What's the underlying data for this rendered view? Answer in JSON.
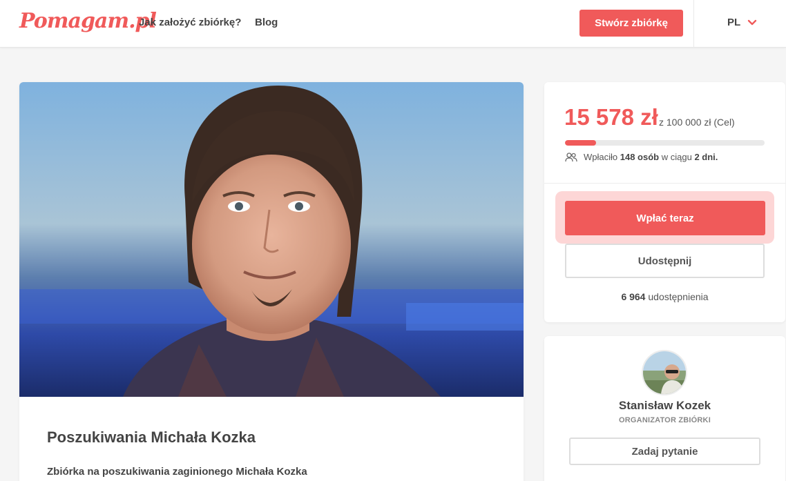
{
  "header": {
    "logo": "Pomagam.pl",
    "nav": {
      "how_to": "Jak założyć zbiórkę?",
      "blog": "Blog"
    },
    "create_button": "Stwórz zbiórkę",
    "language": "PL",
    "accent_color": "#f05a5a"
  },
  "campaign": {
    "title": "Poszukiwania Michała Kozka",
    "subtitle": "Zbiórka na poszukiwania zaginionego Michała Kozka"
  },
  "donation": {
    "raised": "15 578 zł",
    "goal": "z 100 000 zł (Cel)",
    "progress_fraction": 0.156,
    "donors_prefix": "Wpłaciło",
    "donors_count": "148 osób",
    "donors_middle": "w ciągu",
    "donors_days": "2 dni.",
    "pay_button": "Wpłać teraz",
    "share_button": "Udostępnij",
    "shares_count": "6 964",
    "shares_label": "udostępnienia"
  },
  "organizer": {
    "name": "Stanisław Kozek",
    "role": "ORGANIZATOR ZBIÓRKI",
    "ask_button": "Zadaj pytanie"
  }
}
